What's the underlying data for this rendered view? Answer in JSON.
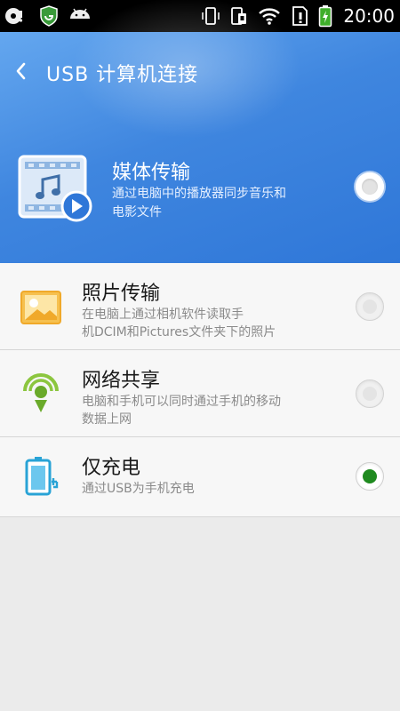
{
  "status_bar": {
    "time": "20:00",
    "left_icons": [
      "app-icon",
      "shield-icon",
      "android-icon"
    ],
    "right_icons": [
      "vibrate-icon",
      "rotate-icon",
      "wifi-icon",
      "sim-icon",
      "battery-icon"
    ]
  },
  "header": {
    "title": "USB 计算机连接",
    "back_icon": "chevron-left-icon"
  },
  "options": [
    {
      "id": "media",
      "title": "媒体传输",
      "desc_line1": "通过电脑中的播放器同步音乐和",
      "desc_line2": "电影文件",
      "icon": "media-transfer-icon",
      "checked": false
    },
    {
      "id": "photo",
      "title": "照片传输",
      "desc_line1": "在电脑上通过相机软件读取手",
      "desc_line2": "机DCIM和Pictures文件夹下的照片",
      "icon": "photo-icon",
      "checked": false
    },
    {
      "id": "network",
      "title": "网络共享",
      "desc_line1": "电脑和手机可以同时通过手机的移动",
      "desc_line2": "数据上网",
      "icon": "tethering-icon",
      "checked": false
    },
    {
      "id": "charge",
      "title": "仅充电",
      "desc_line1": "通过USB为手机充电",
      "desc_line2": "",
      "icon": "charging-icon",
      "checked": true
    }
  ],
  "colors": {
    "header_blue": "#3f86df",
    "checked_green": "#1f8a1f"
  }
}
